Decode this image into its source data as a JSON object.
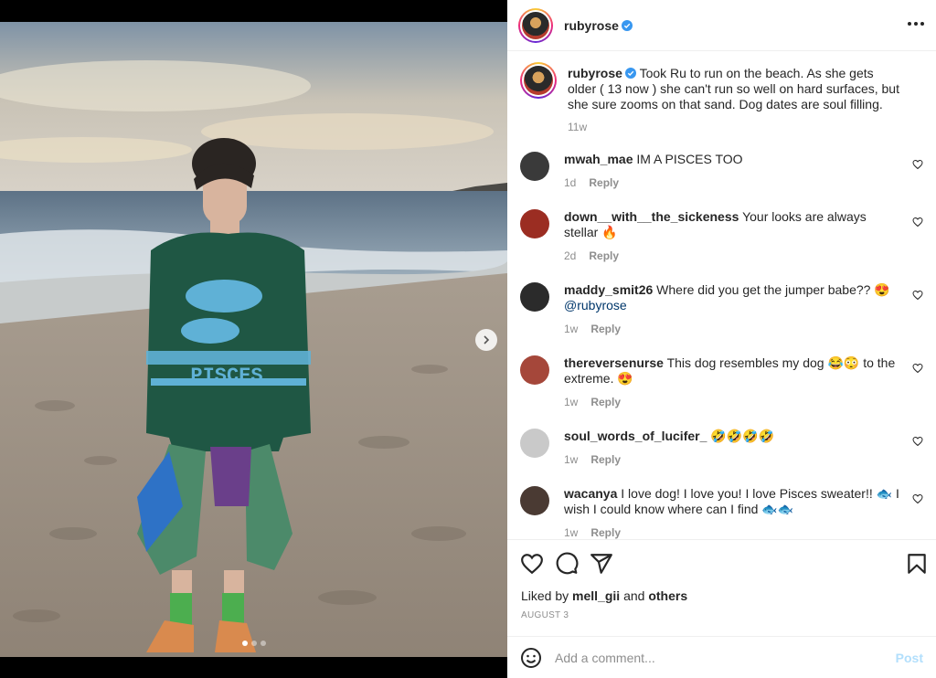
{
  "post": {
    "username": "rubyrose",
    "caption": "Took Ru to run on the beach. As she gets older ( 13 now ) she can't run so well on hard surfaces, but she sure zooms on that sand. Dog dates are soul filling.",
    "caption_time": "11w",
    "photo_sweater_text": "PISCES"
  },
  "comments": [
    {
      "user": "mwah_mae",
      "text": "IM A PISCES TOO",
      "time": "1d",
      "reply": "Reply",
      "avatar_color": "#3a3a3a"
    },
    {
      "user": "down__with__the_sickeness",
      "text": "Your looks are always stellar 🔥",
      "time": "2d",
      "reply": "Reply",
      "avatar_color": "#9b2d22"
    },
    {
      "user": "maddy_smit26",
      "text": "Where did you get the jumper babe?? 😍",
      "mention": "@rubyrose",
      "time": "1w",
      "reply": "Reply",
      "avatar_color": "#2b2b2b"
    },
    {
      "user": "thereversenurse",
      "text": "This dog resembles my dog 😂😳 to the extreme. 😍",
      "time": "1w",
      "reply": "Reply",
      "avatar_color": "#a5473a"
    },
    {
      "user": "soul_words_of_lucifer_",
      "text": "🤣🤣🤣🤣",
      "time": "1w",
      "reply": "Reply",
      "avatar_color": "#c9c9c9"
    },
    {
      "user": "wacanya",
      "text": "I love dog! I love you! I love Pisces sweater!! 🐟 I wish I could know where can I find 🐟🐟",
      "time": "1w",
      "reply": "Reply",
      "avatar_color": "#4a3a33"
    }
  ],
  "likes": {
    "prefix": "Liked by ",
    "user": "mell_gii",
    "middle": " and ",
    "others": "others"
  },
  "date": "AUGUST 3",
  "add_comment": {
    "placeholder": "Add a comment...",
    "post_label": "Post"
  },
  "colors": {
    "verified": "#3897f0",
    "link": "#00376b",
    "post_disabled": "#b2dffc",
    "muted": "#8e8e8e"
  },
  "icons": [
    "verified-badge-icon",
    "more-options-icon",
    "heart-icon",
    "comment-icon",
    "share-icon",
    "bookmark-icon",
    "emoji-icon",
    "chevron-right-icon"
  ]
}
